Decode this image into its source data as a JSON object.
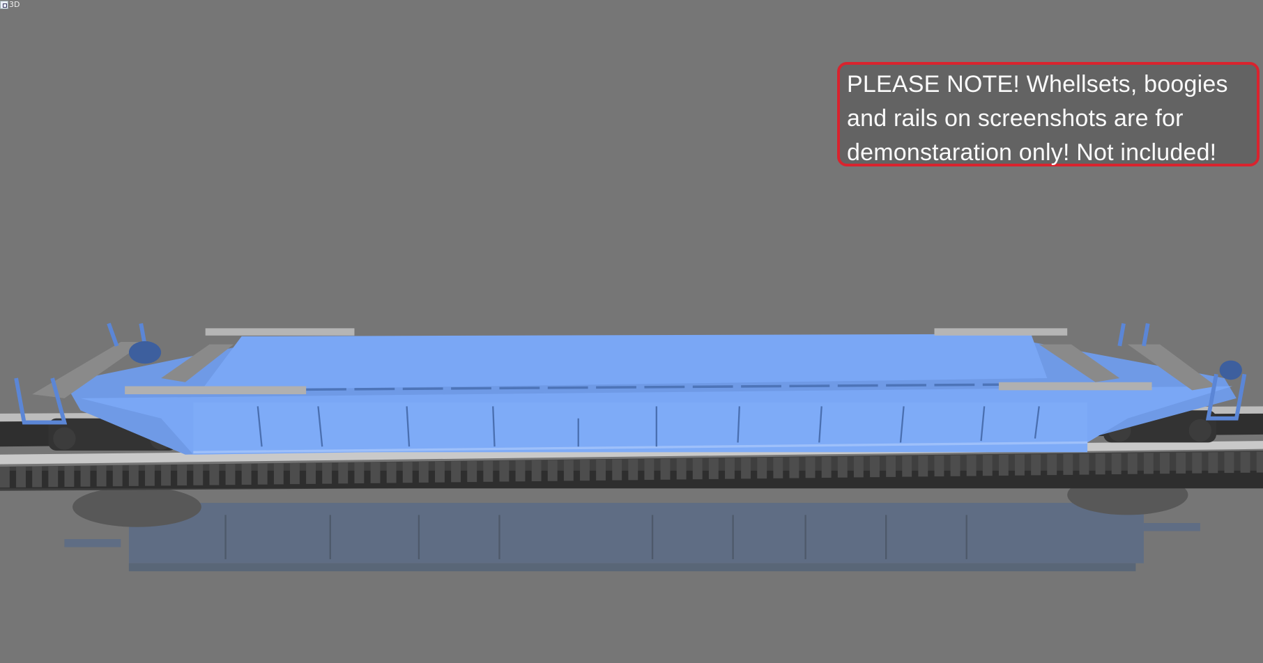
{
  "viewer": {
    "mode_label": "3D"
  },
  "note": {
    "lines": [
      "PLEASE NOTE! Whellsets, boogies",
      "and rails on screenshots are for",
      "demonstaration only! Not included!"
    ]
  },
  "colors": {
    "background": "#767676",
    "car_body": "#7aa7f5",
    "note_border": "#d9232e"
  }
}
